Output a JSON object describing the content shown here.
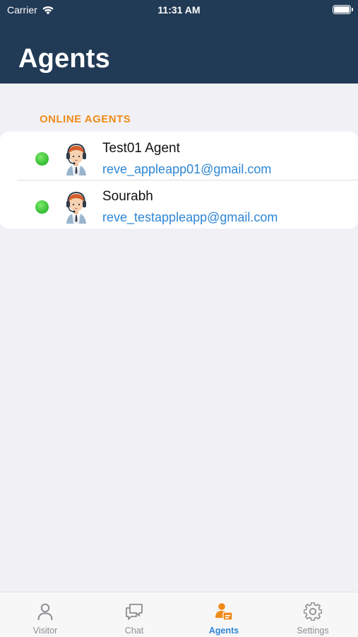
{
  "status_bar": {
    "carrier": "Carrier",
    "time": "11:31 AM"
  },
  "header": {
    "title": "Agents",
    "background_color": "#213a55"
  },
  "section": {
    "title": "ONLINE AGENTS",
    "color": "#ef8b19"
  },
  "agents": [
    {
      "name": "Test01 Agent",
      "email": "reve_appleapp01@gmail.com",
      "status": "online",
      "avatar_icon": "agent-headset-avatar-icon"
    },
    {
      "name": "Sourabh",
      "email": "reve_testappleapp@gmail.com",
      "status": "online",
      "avatar_icon": "agent-headset-avatar-icon"
    }
  ],
  "tabs": [
    {
      "label": "Visitor",
      "icon": "person-icon",
      "active": false
    },
    {
      "label": "Chat",
      "icon": "chat-bubbles-icon",
      "active": false
    },
    {
      "label": "Agents",
      "icon": "agents-icon",
      "active": true
    },
    {
      "label": "Settings",
      "icon": "gear-icon",
      "active": false
    }
  ],
  "colors": {
    "accent": "#2f86d4",
    "online": "#3cc23a",
    "active_tab_icon": "#f08a1c"
  }
}
